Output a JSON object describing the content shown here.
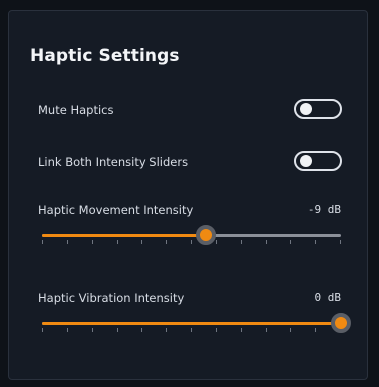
{
  "panel": {
    "title": "Haptic Settings",
    "mute_haptics": {
      "label": "Mute Haptics",
      "on": false
    },
    "link_sliders": {
      "label": "Link Both Intensity Sliders",
      "on": false
    },
    "movement_intensity": {
      "label": "Haptic Movement Intensity",
      "value": "-9 dB",
      "level": 0.55
    },
    "vibration_intensity": {
      "label": "Haptic Vibration Intensity",
      "value": "0 dB",
      "level": 1.0
    }
  },
  "colors": {
    "accent": "#f08a12",
    "track": "#8b9099",
    "panel": "#151b25",
    "background": "#0e1218"
  }
}
